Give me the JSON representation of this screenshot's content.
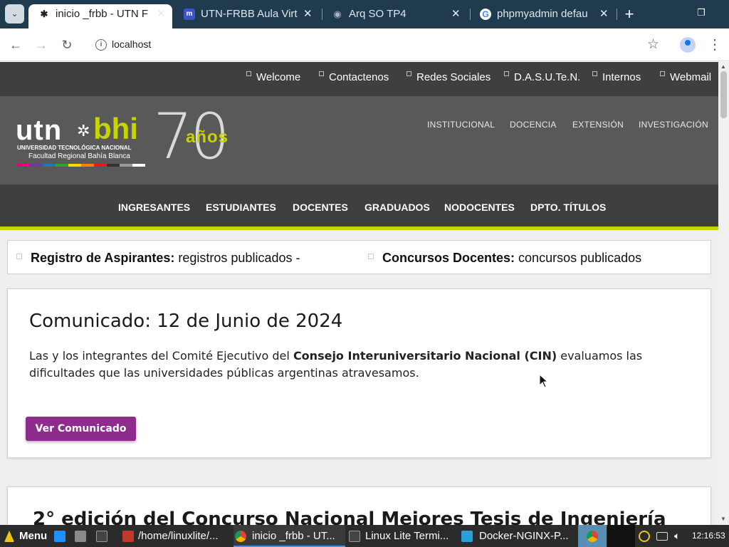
{
  "browser": {
    "tabs": [
      {
        "label": "inicio _frbb - UTN F",
        "icon": "utn-favicon",
        "active": true
      },
      {
        "label": "UTN-FRBB Aula Virt",
        "icon": "moodle-favicon",
        "active": false
      },
      {
        "label": "Arq SO TP4",
        "icon": "globe-icon",
        "active": false
      },
      {
        "label": "phpmyadmin defau",
        "icon": "google-icon",
        "active": false
      }
    ],
    "url": "localhost"
  },
  "site": {
    "toplinks": [
      "Welcome",
      "Contactenos",
      "Redes Sociales",
      "D.A.S.U.Te.N.",
      "Internos",
      "Webmail"
    ],
    "logo": {
      "utn": "utn",
      "bhi": "bhi",
      "sub1": "UNIVERSIDAD TECNOLÓGICA NACIONAL",
      "sub2": "Facultad Regional Bahía Blanca",
      "seventy": "70",
      "anos": "años"
    },
    "header_menu": [
      "INSTITUCIONAL",
      "DOCENCIA",
      "EXTENSIÓN",
      "INVESTIGACIÓN"
    ],
    "main_nav": [
      "INGRESANTES",
      "ESTUDIANTES",
      "DOCENTES",
      "GRADUADOS",
      "NODOCENTES",
      "DPTO. TÍTULOS"
    ],
    "marquee": [
      {
        "bold": "Registro de Aspirantes:",
        "text": " registros publicados -"
      },
      {
        "bold": "Concursos Docentes:",
        "text": " concursos publicados"
      }
    ],
    "announcement": {
      "title": "Comunicado: 12 de Junio de 2024",
      "text_pre": "Las y los integrantes del Comité Ejecutivo del ",
      "text_bold": "Consejo Interuniversitario Nacional (CIN)",
      "text_post": " evaluamos las dificultades que las universidades públicas argentinas atravesamos.",
      "button": "Ver Comunicado"
    },
    "next_card_title": "2° edición del Concurso Nacional Mejores Tesis de Ingeniería"
  },
  "taskbar": {
    "menu": "Menu",
    "items": [
      "/home/linuxlite/...",
      "inicio _frbb - UT...",
      "Linux Lite Termi...",
      "Docker-NGINX-P..."
    ],
    "clock": "12:16:53"
  },
  "colors": {
    "accent": "#c8d400",
    "button": "#8e2c8e",
    "tabstrip": "#1f3b4d"
  }
}
